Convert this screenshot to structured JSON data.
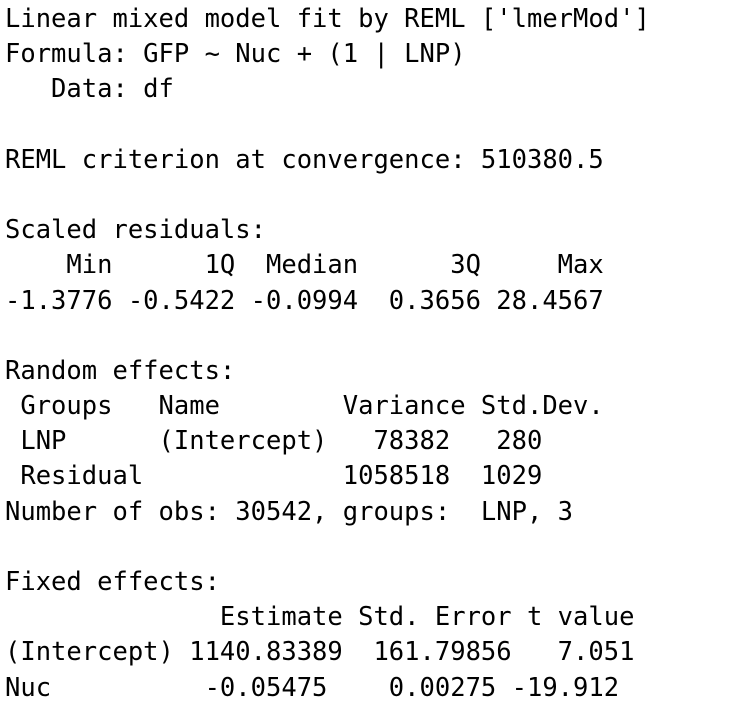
{
  "output": {
    "lines": [
      "Linear mixed model fit by REML ['lmerMod']",
      "Formula: GFP ~ Nuc + (1 | LNP)",
      "   Data: df",
      "",
      "REML criterion at convergence: 510380.5",
      "",
      "Scaled residuals:",
      "    Min      1Q  Median      3Q     Max",
      "-1.3776 -0.5422 -0.0994  0.3656 28.4567",
      "",
      "Random effects:",
      " Groups   Name        Variance Std.Dev.",
      " LNP      (Intercept)   78382   280    ",
      " Residual             1058518  1029    ",
      "Number of obs: 30542, groups:  LNP, 3",
      "",
      "Fixed effects:",
      "              Estimate Std. Error t value",
      "(Intercept) 1140.83389  161.79856   7.051",
      "Nuc          -0.05475    0.00275 -19.912"
    ]
  }
}
